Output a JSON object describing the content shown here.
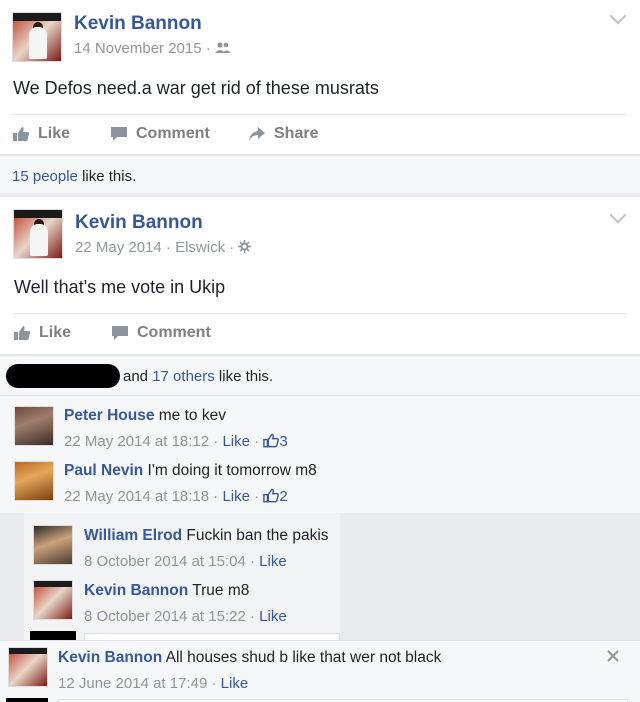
{
  "post1": {
    "author": "Kevin Bannon",
    "date": "14 November 2015",
    "sep": " · ",
    "audience_icon": "friends-icon",
    "text": "We Defos need.a war get rid of these musrats",
    "actions": {
      "like": "Like",
      "comment": "Comment",
      "share": "Share"
    },
    "likes_count_link": "15 people",
    "likes_suffix": " like this."
  },
  "post2": {
    "author": "Kevin Bannon",
    "date": "22 May 2014",
    "place": "Elswick",
    "sep": " · ",
    "audience_icon": "gear-icon",
    "text": "Well that's me vote in Ukip",
    "actions": {
      "like": "Like",
      "comment": "Comment"
    },
    "likes_prefix": "and ",
    "likes_others_link": "17 others",
    "likes_suffix": " like this.",
    "comments": [
      {
        "name": "Peter House",
        "text": " me to kev",
        "time": "22 May 2014 at 18:12",
        "like": "Like",
        "likes": "3"
      },
      {
        "name": "Paul Nevin",
        "text": " I'm doing it tomorrow m8",
        "time": "22 May 2014 at 18:18",
        "like": "Like",
        "likes": "2"
      }
    ],
    "replies": [
      {
        "name": "William Elrod",
        "text": " Fuckin ban the pakis",
        "time": "8 October 2014 at 15:04",
        "like": "Like"
      },
      {
        "name": "Kevin Bannon",
        "text": " True m8",
        "time": "8 October 2014 at 15:22",
        "like": "Like"
      }
    ]
  },
  "overlay_comment": {
    "name": "Kevin Bannon",
    "text": " All houses shud b like that wer not black",
    "time": "12 June 2014 at 17:49",
    "like": "Like"
  },
  "colors": {
    "link": "#365899",
    "muted": "#90949c",
    "bg": "#e9ebee"
  }
}
